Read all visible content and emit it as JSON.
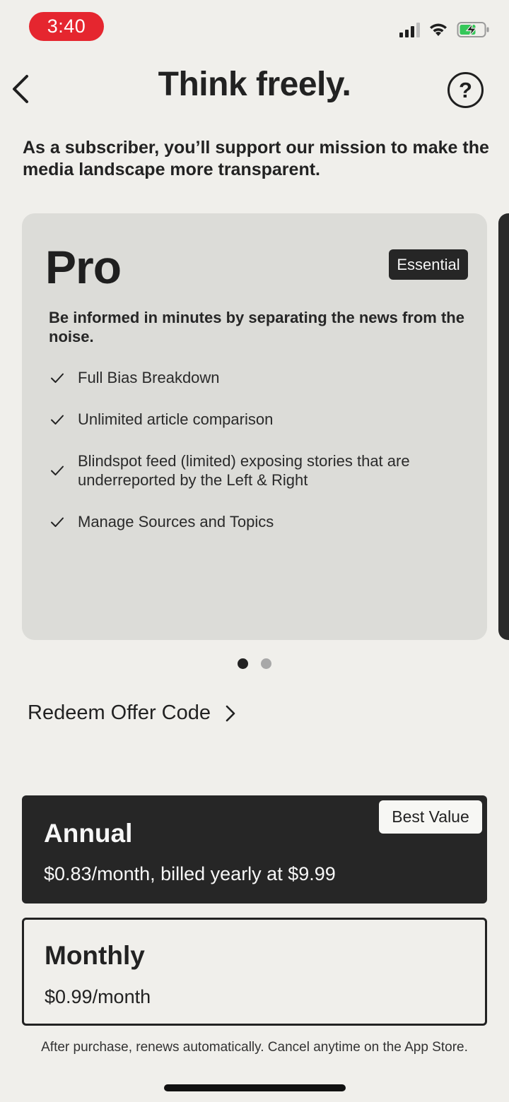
{
  "status_bar": {
    "time": "3:40",
    "signal_icon": "cellular-signal-icon",
    "wifi_icon": "wifi-icon",
    "battery_icon": "battery-charging-icon",
    "time_pill_color": "#e5262f",
    "battery_color": "#35c759"
  },
  "header": {
    "title": "Think freely.",
    "back_icon": "chevron-left-icon",
    "help_glyph": "?"
  },
  "subtitle": "As a subscriber, you’ll support our mission to make the media landscape more transparent.",
  "plan": {
    "name": "Pro",
    "badge": "Essential",
    "description": "Be informed in minutes by separating the news from the noise.",
    "features": [
      "Full Bias Breakdown",
      "Unlimited article comparison",
      "Blindspot feed (limited) exposing stories that are underreported by the Left & Right",
      "Manage Sources and Topics"
    ]
  },
  "pager": {
    "count": 2,
    "active_index": 0
  },
  "redeem": {
    "label": "Redeem Offer Code"
  },
  "options": {
    "annual": {
      "title": "Annual",
      "price": "$0.83/month, billed yearly at $9.99",
      "badge": "Best Value",
      "selected": true
    },
    "monthly": {
      "title": "Monthly",
      "price": "$0.99/month",
      "selected": false
    }
  },
  "footer": "After purchase, renews automatically. Cancel anytime on the App Store.",
  "colors": {
    "background": "#f0efeb",
    "card": "#dcdcd8",
    "dark": "#262626"
  }
}
